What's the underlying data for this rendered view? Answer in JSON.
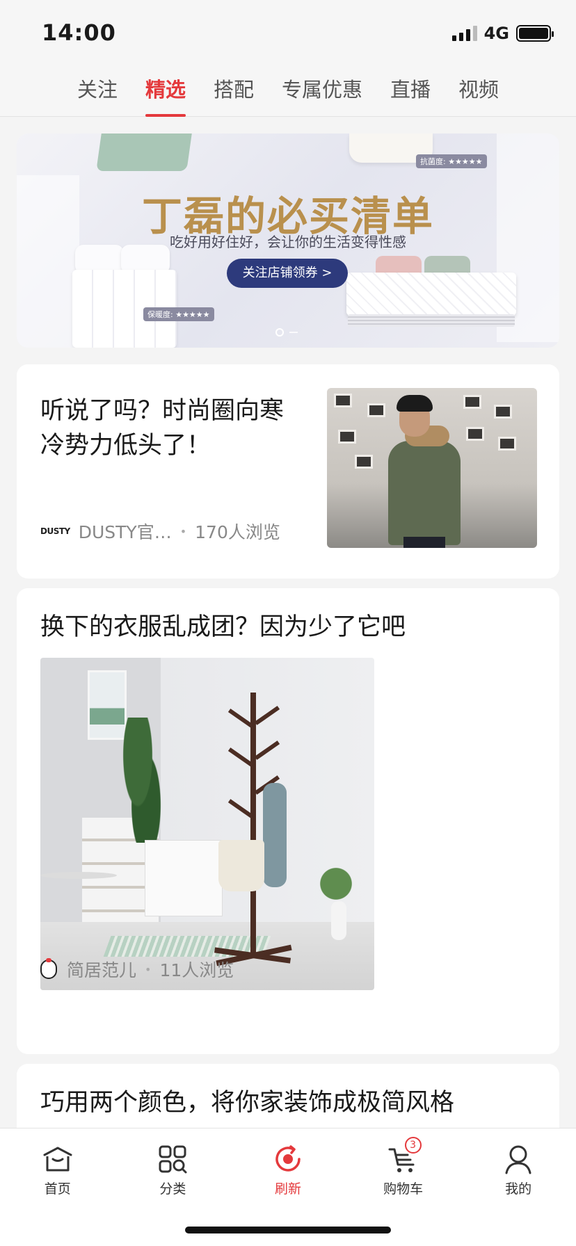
{
  "status_bar": {
    "time": "14:00",
    "network": "4G"
  },
  "tabs": [
    {
      "label": "关注",
      "active": false
    },
    {
      "label": "精选",
      "active": true
    },
    {
      "label": "搭配",
      "active": false
    },
    {
      "label": "专属优惠",
      "active": false
    },
    {
      "label": "直播",
      "active": false
    },
    {
      "label": "视频",
      "active": false
    }
  ],
  "banner": {
    "title": "丁磊的必买清单",
    "subtitle": "吃好用好住好，会让你的生活变得性感",
    "button": "关注店铺领券 >",
    "tag_left": "保暖度: ★★★★★",
    "tag_right": "抗菌度: ★★★★★"
  },
  "feed": [
    {
      "title": "听说了吗？时尚圈向寒冷势力低头了！",
      "brand_logo": "DUSTY",
      "author": "DUSTY官…",
      "views": "170人浏览"
    },
    {
      "title": "换下的衣服乱成团？因为少了它吧",
      "author": "简居范儿",
      "views": "11人浏览"
    },
    {
      "title": "巧用两个颜色，将你家装饰成极简风格"
    }
  ],
  "tabbar": {
    "items": [
      {
        "label": "首页",
        "icon": "home-icon"
      },
      {
        "label": "分类",
        "icon": "category-icon"
      },
      {
        "label": "刷新",
        "icon": "refresh-icon",
        "active": true
      },
      {
        "label": "购物车",
        "icon": "cart-icon",
        "badge": "3"
      },
      {
        "label": "我的",
        "icon": "profile-icon"
      }
    ]
  },
  "colors": {
    "accent": "#e4393c",
    "banner_button": "#2d3a7c",
    "banner_title": "#b9904d"
  }
}
